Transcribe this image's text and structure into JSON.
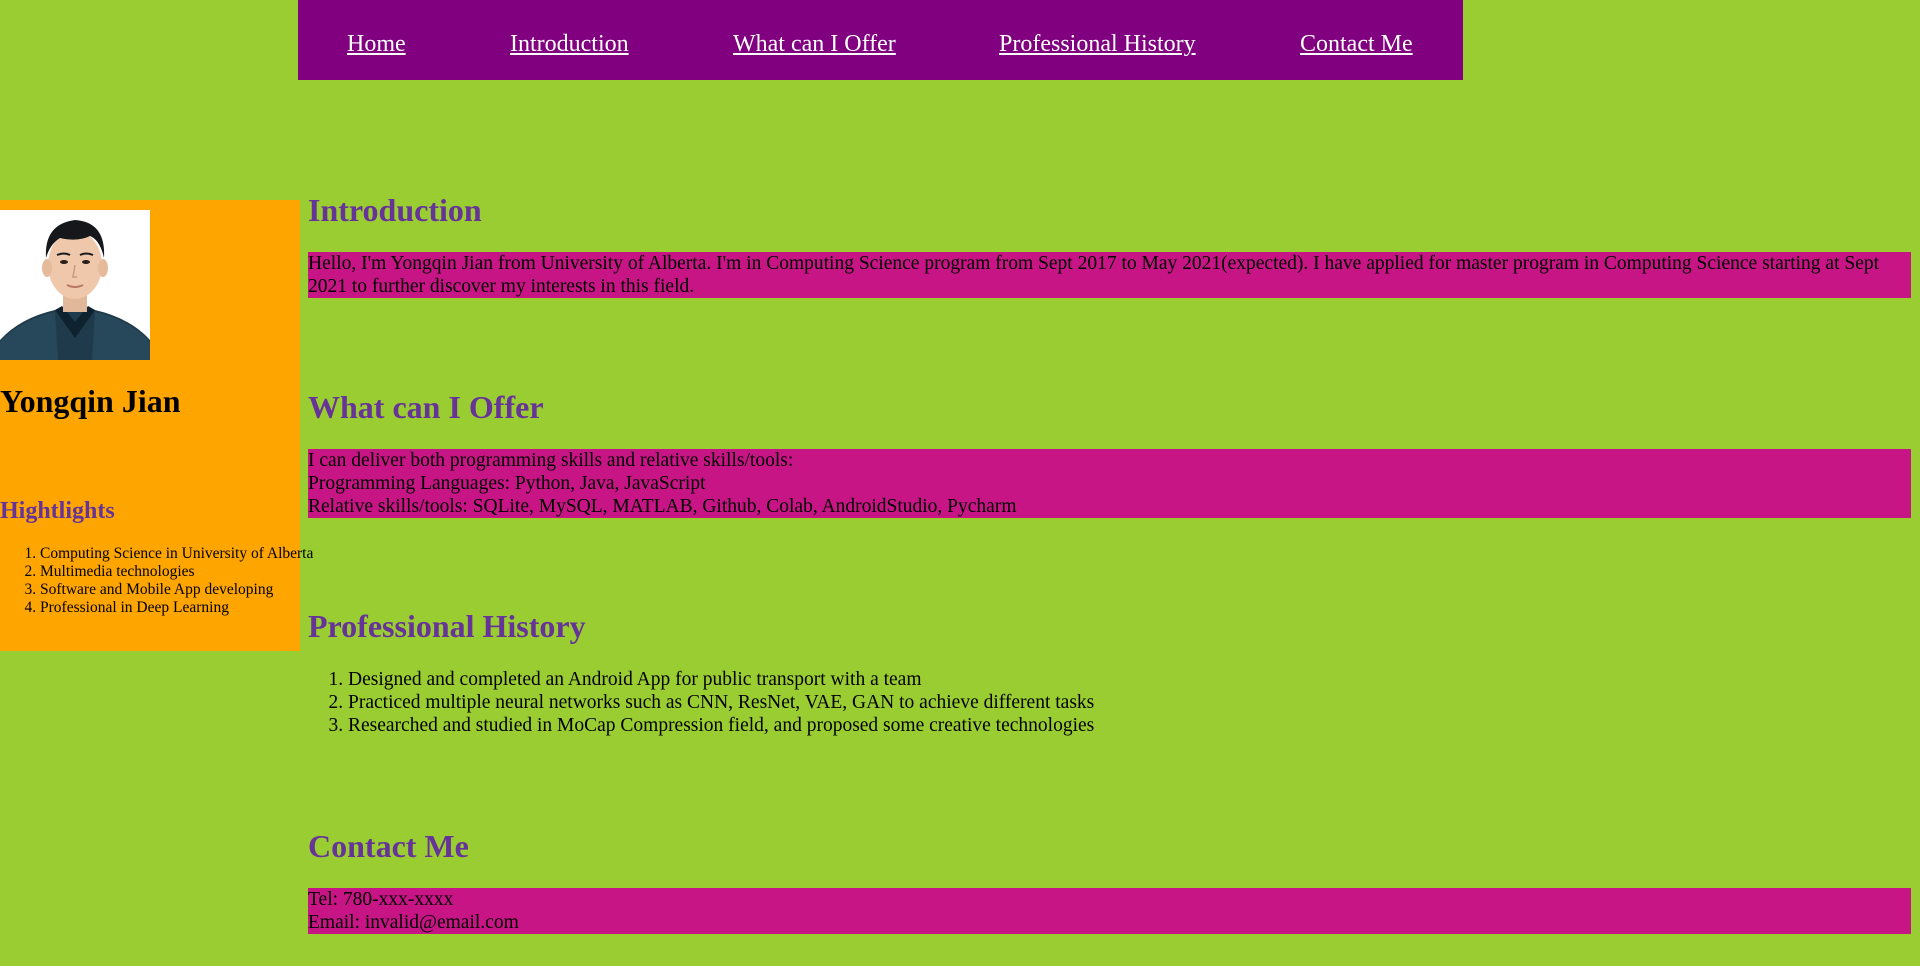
{
  "nav": {
    "home": "Home",
    "introduction": "Introduction",
    "offer": "What can I Offer",
    "history": "Professional History",
    "contact": "Contact Me"
  },
  "sidebar": {
    "name": "Yongqin Jian",
    "highlights_title": "Hightlights",
    "highlights": [
      "Computing Science in University of Alberta",
      "Multimedia technologies",
      "Software and Mobile App developing",
      "Professional in Deep Learning"
    ]
  },
  "introduction": {
    "title": "Introduction",
    "text": "Hello, I'm Yongqin Jian from University of Alberta. I'm in Computing Science program from Sept 2017 to May 2021(expected). I have applied for master program in Computing Science starting at Sept 2021 to further discover my interests in this field."
  },
  "offer": {
    "title": "What can I Offer",
    "lines": [
      "I can deliver both programming skills and relative skills/tools:",
      "Programming Languages: Python, Java, JavaScript",
      "Relative skills/tools: SQLite, MySQL, MATLAB, Github, Colab, AndroidStudio, Pycharm"
    ]
  },
  "history": {
    "title": "Professional History",
    "items": [
      "Designed and completed an Android App for public transport with a team",
      "Practiced multiple neural networks such as CNN, ResNet, VAE, GAN to achieve different tasks",
      "Researched and studied in MoCap Compression field, and proposed some creative technologies"
    ]
  },
  "contact": {
    "title": "Contact Me",
    "tel": "Tel: 780-xxx-xxxx",
    "email": "Email: invalid@email.com"
  },
  "colors": {
    "page_background": "#9acd32",
    "nav_background": "#800080",
    "nav_link": "#ffffff",
    "sidebar_background": "#ffa500",
    "heading": "#663399",
    "section_background": "#c71585"
  }
}
